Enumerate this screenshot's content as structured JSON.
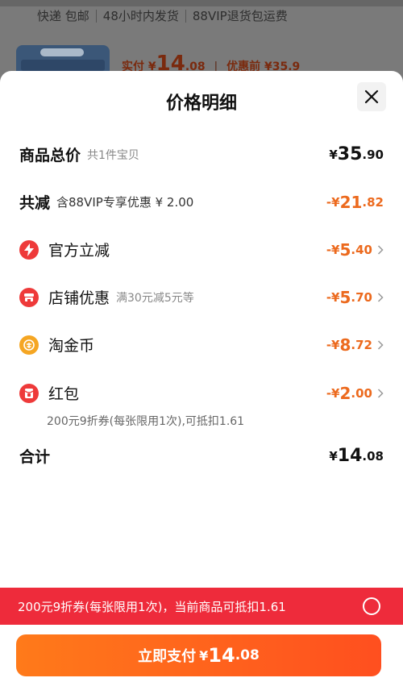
{
  "background": {
    "shipping": [
      "快递 包邮",
      "48小时内发货",
      "88VIP退货包运费"
    ],
    "paid_label": "实付",
    "paid_currency": "¥",
    "paid_int": "14",
    "paid_dec": ".08",
    "before_label": "优惠前",
    "before_value": "¥35.9"
  },
  "sheet": {
    "title": "价格明细",
    "close_icon": "close-icon"
  },
  "rows": {
    "total": {
      "label": "商品总价",
      "sub": "共1件宝贝",
      "cur": "¥",
      "int": "35",
      "dec": ".90"
    },
    "reduce": {
      "label": "共减",
      "sub": "含88VIP专享优惠 ¥ 2.00",
      "cur": "-¥",
      "int": "21",
      "dec": ".82"
    },
    "official": {
      "label": "官方立减",
      "cur": "-¥",
      "int": "5",
      "dec": ".40",
      "icon": "lightning-icon",
      "color": "#ee3a3a"
    },
    "store": {
      "label": "店铺优惠",
      "sub": "满30元减5元等",
      "cur": "-¥",
      "int": "5",
      "dec": ".70",
      "icon": "store-icon",
      "color": "#ee3a3a"
    },
    "coins": {
      "label": "淘金币",
      "cur": "-¥",
      "int": "8",
      "dec": ".72",
      "icon": "coin-icon",
      "color": "#f5a623"
    },
    "redpacket": {
      "label": "红包",
      "cur": "-¥",
      "int": "2",
      "dec": ".00",
      "icon": "red-packet-icon",
      "color": "#ee3a3a",
      "note": "200元9折券(每张限用1次),可抵扣1.61"
    },
    "sum": {
      "label": "合计",
      "cur": "¥",
      "int": "14",
      "dec": ".08"
    }
  },
  "coupon_bar": {
    "text": "200元9折券(每张限用1次)，当前商品可抵扣1.61"
  },
  "pay_button": {
    "label": "立即支付",
    "cur": "¥",
    "int": "14",
    "dec": ".08"
  },
  "colors": {
    "accent_orange": "#ec6a1e",
    "banner_red": "#ee2b3b"
  }
}
